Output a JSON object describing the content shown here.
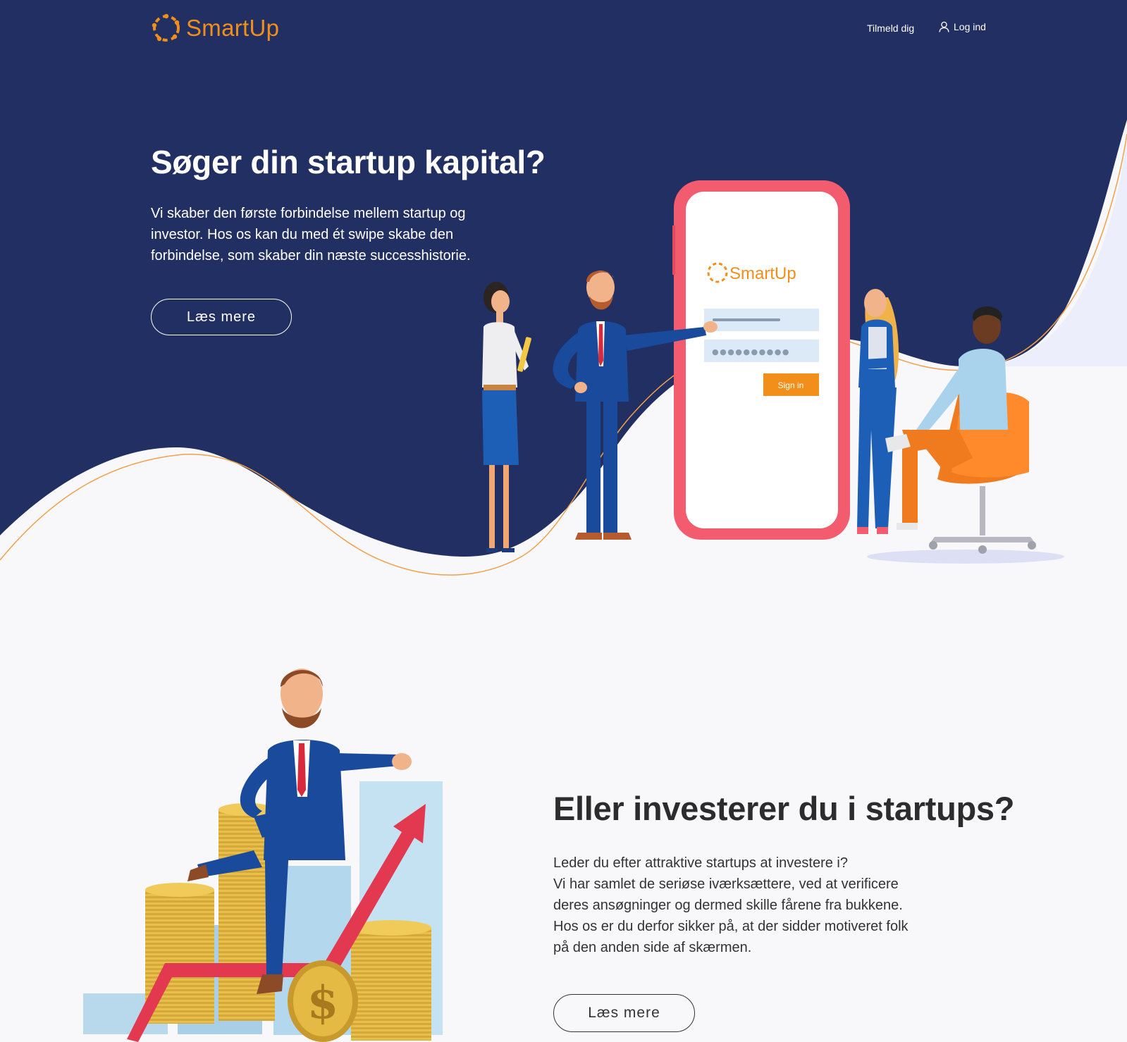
{
  "brand": {
    "name": "SmartUp",
    "color": "#f18f1a"
  },
  "colors": {
    "navy": "#212f62",
    "accent_orange": "#f18f1a",
    "phone_frame": "#f25c6e",
    "light_bg": "#f8f8fb"
  },
  "nav": {
    "signup_label": "Tilmeld dig",
    "login_label": "Log ind",
    "login_icon": "user-icon"
  },
  "hero": {
    "title": "Søger din startup kapital?",
    "text": "Vi skaber den første forbindelse mellem startup og investor. Hos os kan du med ét swipe skabe den forbindelse, som skaber din næste successhistorie.",
    "cta_label": "Læs mere"
  },
  "phone_mockup": {
    "brand": "SmartUp",
    "password_mask": "●●●●●●●●●●",
    "sign_in_label": "Sign in"
  },
  "investor_section": {
    "title": "Eller investerer du i startups?",
    "lines": [
      "Leder du efter attraktive startups at investere i?",
      "Vi har samlet de seriøse iværksættere, ved at verificere",
      "deres ansøgninger og dermed skille fårene fra bukkene.",
      "Hos os er du derfor sikker på, at der sidder motiveret folk",
      "på den anden side af skærmen."
    ],
    "cta_label": "Læs mere"
  }
}
